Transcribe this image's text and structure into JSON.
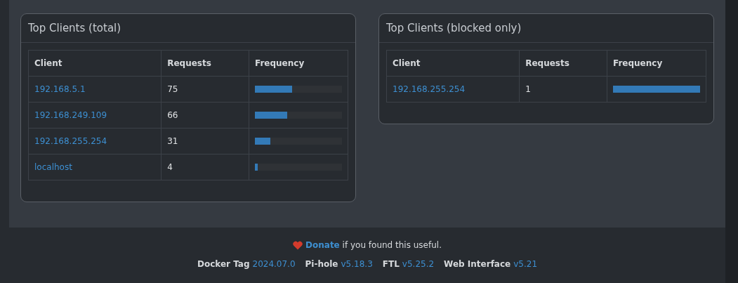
{
  "cards": [
    {
      "title": "Top Clients (total)",
      "columns": [
        "Client",
        "Requests",
        "Frequency"
      ],
      "rows": [
        {
          "client": "192.168.5.1",
          "requests": "75",
          "level": 0.43
        },
        {
          "client": "192.168.249.109",
          "requests": "66",
          "level": 0.37
        },
        {
          "client": "192.168.255.254",
          "requests": "31",
          "level": 0.18
        },
        {
          "client": "localhost",
          "requests": "4",
          "level": 0.03
        }
      ]
    },
    {
      "title": "Top Clients (blocked only)",
      "columns": [
        "Client",
        "Requests",
        "Frequency"
      ],
      "rows": [
        {
          "client": "192.168.255.254",
          "requests": "1",
          "level": 1
        }
      ]
    }
  ],
  "footer": {
    "donate": {
      "link": "Donate",
      "text": "if you found this useful."
    },
    "versions": [
      {
        "label": "Docker Tag",
        "value": "2024.07.0"
      },
      {
        "label": "Pi-hole",
        "value": "v5.18.3"
      },
      {
        "label": "FTL",
        "value": "v5.25.2"
      },
      {
        "label": "Web Interface",
        "value": "v5.21"
      }
    ]
  }
}
